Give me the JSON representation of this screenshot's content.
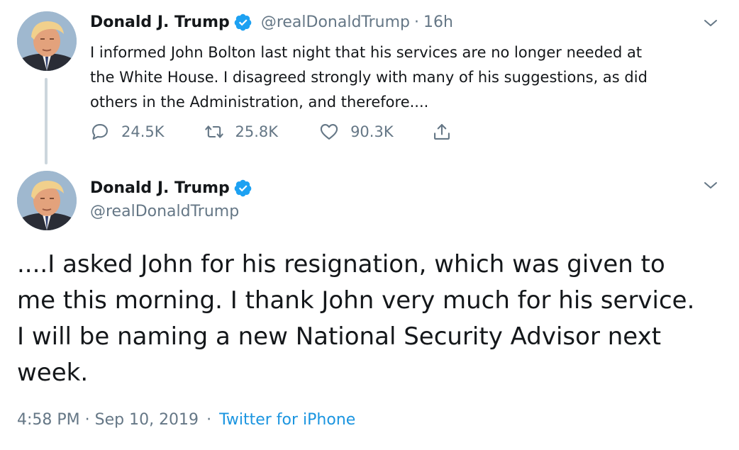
{
  "tweet1": {
    "author_name": "Donald J. Trump",
    "handle": "@realDonaldTrump",
    "separator": "·",
    "time": "16h",
    "text": "I informed John Bolton last night that his services are no longer needed at\nthe White House. I disagreed strongly with many of his suggestions, as did\nothers in the Administration, and therefore....",
    "actions": {
      "reply_count": "24.5K",
      "retweet_count": "25.8K",
      "like_count": "90.3K"
    }
  },
  "tweet2": {
    "author_name": "Donald J. Trump",
    "handle": "@realDonaldTrump",
    "text": "....I asked John for his resignation, which was given to\nme this morning. I thank John very much for his service.\nI will be naming a new National Security Advisor next\nweek.",
    "timestamp": "4:58 PM · Sep 10, 2019",
    "separator": "·",
    "source": "Twitter for iPhone"
  },
  "icons": {
    "verified": "verified-badge-icon",
    "chevron": "chevron-down-icon",
    "reply": "reply-icon",
    "retweet": "retweet-icon",
    "like": "heart-icon",
    "share": "share-icon"
  },
  "colors": {
    "accent": "#1da1f2",
    "source_link": "#1b95e0",
    "secondary_text": "#657786",
    "thread_line": "#ccd6dd"
  }
}
